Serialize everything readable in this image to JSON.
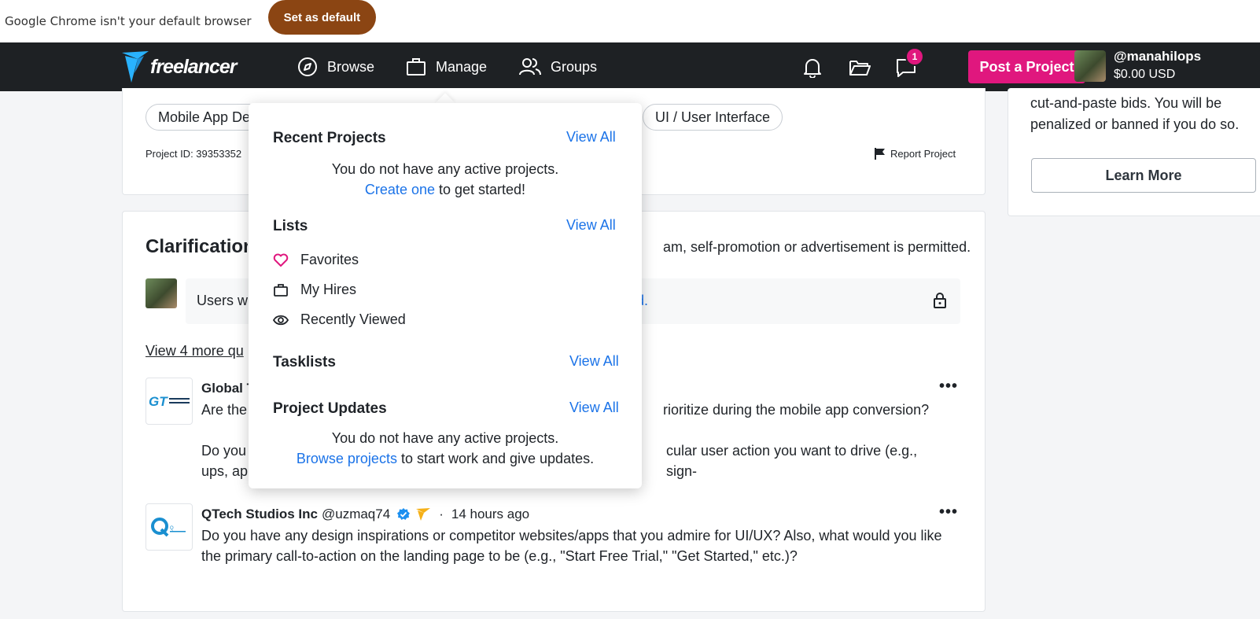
{
  "chrome_bar": {
    "message": "Google Chrome isn't your default browser",
    "button": "Set as default"
  },
  "nav": {
    "logo_text": "freelancer",
    "browse": "Browse",
    "manage": "Manage",
    "groups": "Groups",
    "message_badge": "1",
    "post_project": "Post a Project",
    "username": "@manahilops",
    "balance": "$0.00 USD"
  },
  "project": {
    "skill_chips": [
      "Mobile App De",
      "UI / User Interface"
    ],
    "project_id": "Project ID: 39353352",
    "report": "Report Project"
  },
  "sidebar": {
    "warning_text": "cut-and-paste bids. You will be penalized or banned if you do so.",
    "learn_more": "Learn More"
  },
  "clarification": {
    "title": "Clarification",
    "note": "am, self-promotion or advertisement is permitted.",
    "locked_text": "Users w",
    "locked_link": "ed.",
    "view_more": "View 4 more qu",
    "questions": [
      {
        "author": "Global T",
        "logo_text": "GT",
        "line1a": "Are the",
        "line1b": "rioritize during the mobile app conversion?",
        "p2a": "Do you",
        "p2b": "ups, ap",
        "p2c": "cular user action you want to drive (e.g., sign-"
      },
      {
        "author": "QTech Studios Inc",
        "handle": "@uzmaq74",
        "dot": "·",
        "time": "14 hours ago",
        "logo_text": "Q",
        "body": "Do you have any design inspirations or competitor websites/apps that you admire for UI/UX? Also, what would you like the primary call-to-action on the landing page to be (e.g., \"Start Free Trial,\" \"Get Started,\" etc.)?"
      }
    ],
    "more_label": "•••"
  },
  "manage_dropdown": {
    "recent_projects": {
      "title": "Recent Projects",
      "view_all": "View All",
      "empty": "You do not have any active projects.",
      "link": "Create one",
      "suffix": " to get started!"
    },
    "lists": {
      "title": "Lists",
      "view_all": "View All",
      "items": [
        "Favorites",
        "My Hires",
        "Recently Viewed"
      ]
    },
    "tasklists": {
      "title": "Tasklists",
      "view_all": "View All"
    },
    "project_updates": {
      "title": "Project Updates",
      "view_all": "View All",
      "empty": "You do not have any active projects.",
      "link": "Browse projects",
      "suffix": " to start work and give updates."
    }
  },
  "colors": {
    "brand_pink": "#e0177e",
    "link_blue": "#1b73e8",
    "navbar": "#1e2124",
    "chrome_button": "#8b4513"
  }
}
